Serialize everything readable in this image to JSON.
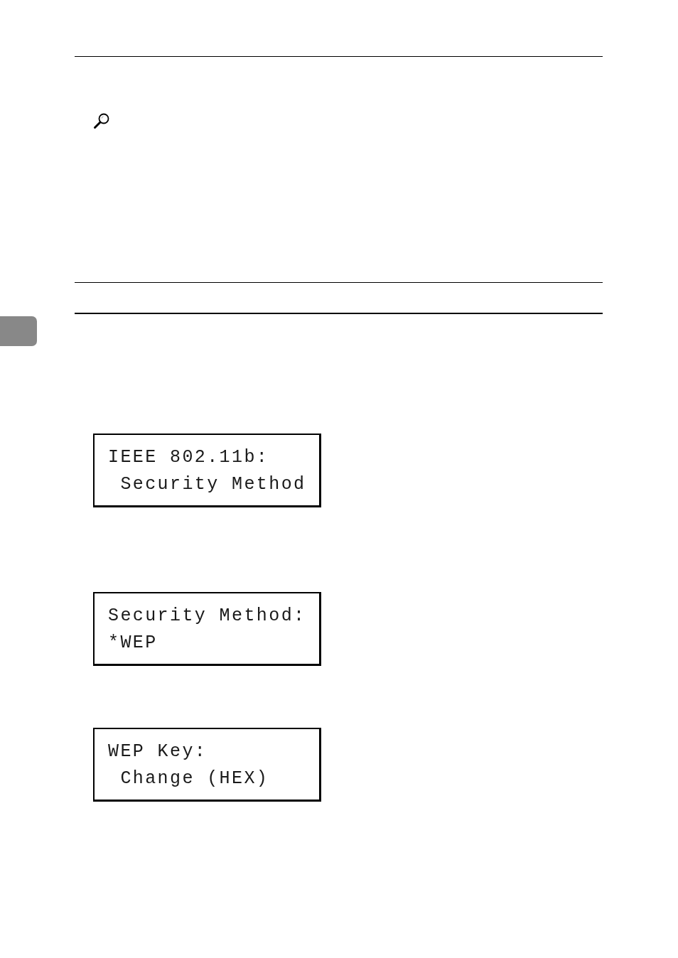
{
  "lcd_screens": [
    {
      "lines": [
        "IEEE 802.11b:",
        " Security Method"
      ]
    },
    {
      "lines": [
        "Security Method:",
        "*WEP"
      ]
    },
    {
      "lines": [
        "WEP Key:",
        " Change (HEX)"
      ]
    }
  ]
}
